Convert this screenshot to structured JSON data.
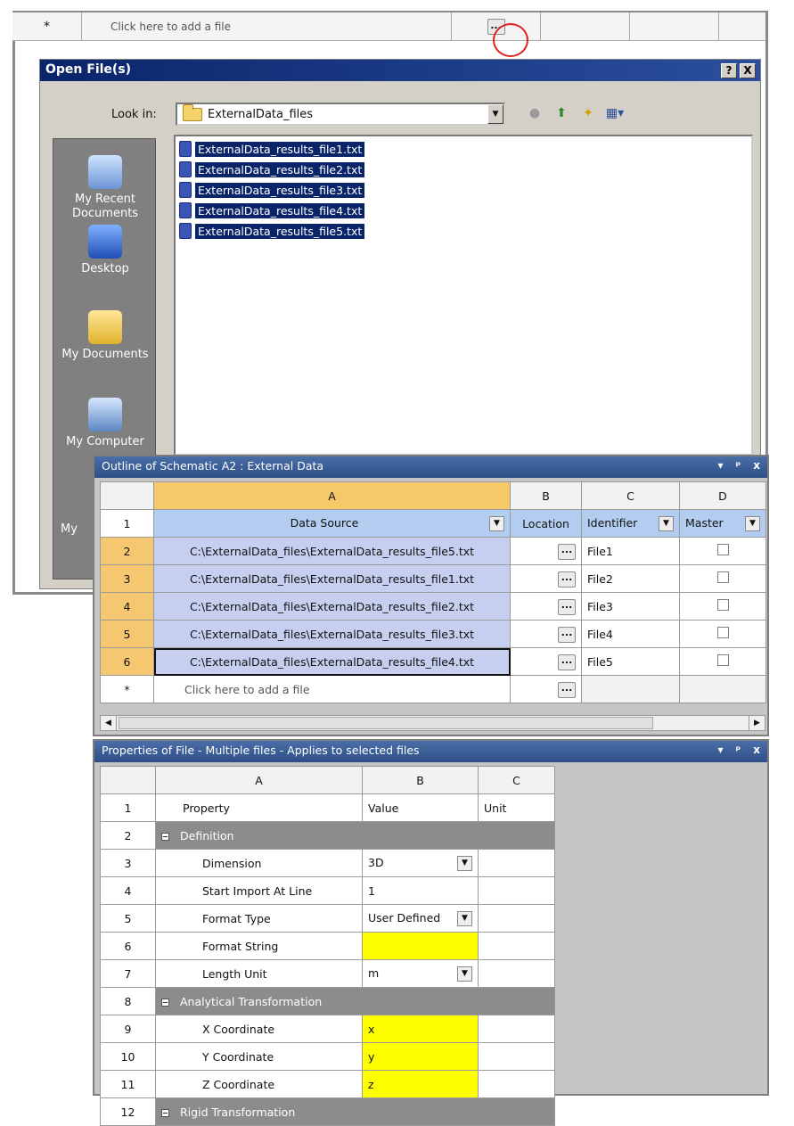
{
  "top_row": {
    "star": "*",
    "add_prompt": "Click here to add a file",
    "browse_label": "..."
  },
  "dialog": {
    "title": "Open File(s)",
    "help_btn": "?",
    "close_btn": "X",
    "look_in_label": "Look in:",
    "look_in_value": "ExternalData_files",
    "places": [
      {
        "label": "My Recent Documents",
        "icon": "recent-documents-icon"
      },
      {
        "label": "Desktop",
        "icon": "desktop-icon"
      },
      {
        "label": "My Documents",
        "icon": "my-documents-icon"
      },
      {
        "label": "My Computer",
        "icon": "my-computer-icon"
      },
      {
        "label": "My",
        "icon": "my-network-icon"
      }
    ],
    "files": [
      "ExternalData_results_file1.txt",
      "ExternalData_results_file2.txt",
      "ExternalData_results_file3.txt",
      "ExternalData_results_file4.txt",
      "ExternalData_results_file5.txt"
    ]
  },
  "outline": {
    "title": "Outline of Schematic A2 : External Data",
    "tools": [
      "▾",
      "ᵖ",
      "x"
    ],
    "col_letters": [
      "A",
      "B",
      "C",
      "D"
    ],
    "headers": [
      "Data Source",
      "Location",
      "Identifier",
      "Master"
    ],
    "rows": [
      {
        "num": "2",
        "source": "C:\\ExternalData_files\\ExternalData_results_file5.txt",
        "id": "File1"
      },
      {
        "num": "3",
        "source": "C:\\ExternalData_files\\ExternalData_results_file1.txt",
        "id": "File2"
      },
      {
        "num": "4",
        "source": "C:\\ExternalData_files\\ExternalData_results_file2.txt",
        "id": "File3"
      },
      {
        "num": "5",
        "source": "C:\\ExternalData_files\\ExternalData_results_file3.txt",
        "id": "File4"
      },
      {
        "num": "6",
        "source": "C:\\ExternalData_files\\ExternalData_results_file4.txt",
        "id": "File5"
      }
    ],
    "header_row_num": "1",
    "add_row_num": "*",
    "add_prompt": "Click here to add a file",
    "browse_label": "..."
  },
  "props": {
    "title": "Properties of File - Multiple files - Applies to selected files",
    "col_letters": [
      "A",
      "B",
      "C"
    ],
    "headers": {
      "num": "1",
      "property": "Property",
      "value": "Value",
      "unit": "Unit"
    },
    "rows": [
      {
        "num": "2",
        "type": "section",
        "label": "Definition"
      },
      {
        "num": "3",
        "type": "combo",
        "label": "Dimension",
        "value": "3D"
      },
      {
        "num": "4",
        "type": "text",
        "label": "Start Import At Line",
        "value": "1"
      },
      {
        "num": "5",
        "type": "combo",
        "label": "Format Type",
        "value": "User Defined"
      },
      {
        "num": "6",
        "type": "yellow",
        "label": "Format String",
        "value": ""
      },
      {
        "num": "7",
        "type": "combo",
        "label": "Length Unit",
        "value": "m"
      },
      {
        "num": "8",
        "type": "section",
        "label": "Analytical Transformation"
      },
      {
        "num": "9",
        "type": "yellow",
        "label": "X Coordinate",
        "value": "x"
      },
      {
        "num": "10",
        "type": "yellow",
        "label": "Y Coordinate",
        "value": "y"
      },
      {
        "num": "11",
        "type": "yellow",
        "label": "Z Coordinate",
        "value": "z"
      },
      {
        "num": "12",
        "type": "section",
        "label": "Rigid Transformation"
      }
    ]
  }
}
